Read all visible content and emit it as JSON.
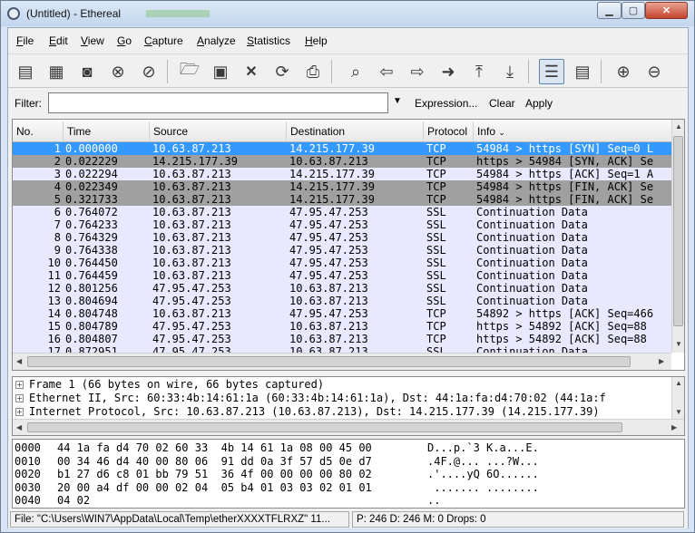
{
  "window": {
    "title": "(Untitled) - Ethereal"
  },
  "menu": [
    {
      "label": "File",
      "u": "F",
      "rest": "ile"
    },
    {
      "label": "Edit",
      "u": "E",
      "rest": "dit"
    },
    {
      "label": "View",
      "u": "V",
      "rest": "iew"
    },
    {
      "label": "Go",
      "u": "G",
      "rest": "o"
    },
    {
      "label": "Capture",
      "u": "C",
      "rest": "apture"
    },
    {
      "label": "Analyze",
      "u": "A",
      "rest": "nalyze"
    },
    {
      "label": "Statistics",
      "u": "S",
      "rest": "tatistics"
    },
    {
      "label": "Help",
      "u": "H",
      "rest": "elp"
    }
  ],
  "filter": {
    "label": "Filter:",
    "value": "",
    "expression": "Expression...",
    "clear": "Clear",
    "apply": "Apply"
  },
  "packet_list": {
    "columns": [
      "No.",
      "Time",
      "Source",
      "Destination",
      "Protocol",
      "Info"
    ],
    "rows": [
      {
        "no": "1",
        "time": "0.000000",
        "src": "10.63.87.213",
        "dst": "14.215.177.39",
        "proto": "TCP",
        "info": "54984 > https [SYN] Seq=0 L",
        "style": "selected"
      },
      {
        "no": "2",
        "time": "0.022229",
        "src": "14.215.177.39",
        "dst": "10.63.87.213",
        "proto": "TCP",
        "info": "https > 54984 [SYN, ACK] Se",
        "style": "gray"
      },
      {
        "no": "3",
        "time": "0.022294",
        "src": "10.63.87.213",
        "dst": "14.215.177.39",
        "proto": "TCP",
        "info": "54984 > https [ACK] Seq=1 A",
        "style": "normal"
      },
      {
        "no": "4",
        "time": "0.022349",
        "src": "10.63.87.213",
        "dst": "14.215.177.39",
        "proto": "TCP",
        "info": "54984 > https [FIN, ACK] Se",
        "style": "gray"
      },
      {
        "no": "5",
        "time": "0.321733",
        "src": "10.63.87.213",
        "dst": "14.215.177.39",
        "proto": "TCP",
        "info": "54984 > https [FIN, ACK] Se",
        "style": "gray"
      },
      {
        "no": "6",
        "time": "0.764072",
        "src": "10.63.87.213",
        "dst": "47.95.47.253",
        "proto": "SSL",
        "info": "Continuation Data",
        "style": "normal"
      },
      {
        "no": "7",
        "time": "0.764233",
        "src": "10.63.87.213",
        "dst": "47.95.47.253",
        "proto": "SSL",
        "info": "Continuation Data",
        "style": "normal"
      },
      {
        "no": "8",
        "time": "0.764329",
        "src": "10.63.87.213",
        "dst": "47.95.47.253",
        "proto": "SSL",
        "info": "Continuation Data",
        "style": "normal"
      },
      {
        "no": "9",
        "time": "0.764338",
        "src": "10.63.87.213",
        "dst": "47.95.47.253",
        "proto": "SSL",
        "info": "Continuation Data",
        "style": "normal"
      },
      {
        "no": "10",
        "time": "0.764450",
        "src": "10.63.87.213",
        "dst": "47.95.47.253",
        "proto": "SSL",
        "info": "Continuation Data",
        "style": "normal"
      },
      {
        "no": "11",
        "time": "0.764459",
        "src": "10.63.87.213",
        "dst": "47.95.47.253",
        "proto": "SSL",
        "info": "Continuation Data",
        "style": "normal"
      },
      {
        "no": "12",
        "time": "0.801256",
        "src": "47.95.47.253",
        "dst": "10.63.87.213",
        "proto": "SSL",
        "info": "Continuation Data",
        "style": "normal"
      },
      {
        "no": "13",
        "time": "0.804694",
        "src": "47.95.47.253",
        "dst": "10.63.87.213",
        "proto": "SSL",
        "info": "Continuation Data",
        "style": "normal"
      },
      {
        "no": "14",
        "time": "0.804748",
        "src": "10.63.87.213",
        "dst": "47.95.47.253",
        "proto": "TCP",
        "info": "54892 > https [ACK] Seq=466",
        "style": "normal"
      },
      {
        "no": "15",
        "time": "0.804789",
        "src": "47.95.47.253",
        "dst": "10.63.87.213",
        "proto": "TCP",
        "info": "https > 54892 [ACK] Seq=88",
        "style": "normal"
      },
      {
        "no": "16",
        "time": "0.804807",
        "src": "47.95.47.253",
        "dst": "10.63.87.213",
        "proto": "TCP",
        "info": "https > 54892 [ACK] Seq=88",
        "style": "normal"
      },
      {
        "no": "17",
        "time": "0.872951",
        "src": "47.95.47.253",
        "dst": "10.63.87.213",
        "proto": "SSL",
        "info": "Continuation Data",
        "style": "normal"
      }
    ]
  },
  "details": [
    "Frame 1 (66 bytes on wire, 66 bytes captured)",
    "Ethernet II, Src: 60:33:4b:14:61:1a (60:33:4b:14:61:1a), Dst: 44:1a:fa:d4:70:02 (44:1a:f",
    "Internet Protocol, Src: 10.63.87.213 (10.63.87.213), Dst: 14.215.177.39 (14.215.177.39)"
  ],
  "bytes": [
    {
      "off": "0000",
      "hex": "44 1a fa d4 70 02 60 33  4b 14 61 1a 08 00 45 00",
      "ascii": "D...p.`3 K.a...E."
    },
    {
      "off": "0010",
      "hex": "00 34 46 d4 40 00 80 06  91 dd 0a 3f 57 d5 0e d7",
      "ascii": ".4F.@... ...?W..."
    },
    {
      "off": "0020",
      "hex": "b1 27 d6 c8 01 bb 79 51  36 4f 00 00 00 00 80 02",
      "ascii": ".'....yQ 6O......"
    },
    {
      "off": "0030",
      "hex": "20 00 a4 df 00 00 02 04  05 b4 01 03 03 02 01 01",
      "ascii": " ....... ........"
    },
    {
      "off": "0040",
      "hex": "04 02",
      "ascii": ".."
    }
  ],
  "status": {
    "file": "File: \"C:\\Users\\WIN7\\AppData\\Local\\Temp\\etherXXXXTFLRXZ\" 11...",
    "packets": "P: 246 D: 246 M: 0 Drops: 0"
  },
  "colors": {
    "selected": "#3399ff",
    "gray": "#a0a0a0",
    "normal": "#e8e8ff",
    "titlebar": "#c9dbf1"
  }
}
